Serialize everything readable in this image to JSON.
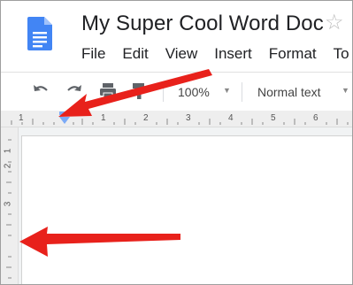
{
  "window": {
    "doc_title": "My Super Cool Word Doc",
    "star_glyph": "☆"
  },
  "menu": {
    "items": [
      "File",
      "Edit",
      "View",
      "Insert",
      "Format",
      "To"
    ]
  },
  "toolbar": {
    "zoom": "100%",
    "style": "Normal text",
    "caret": "▼"
  },
  "ruler": {
    "horizontal_labels": [
      "1",
      "1",
      "2",
      "3",
      "4",
      "5",
      "6"
    ],
    "vertical_labels": [
      "1",
      "2",
      "3"
    ]
  },
  "annotations": {
    "arrow_color": "#e8211b"
  },
  "colors": {
    "docs_blue": "#4285f4",
    "indent_marker": "#7baaf7"
  }
}
